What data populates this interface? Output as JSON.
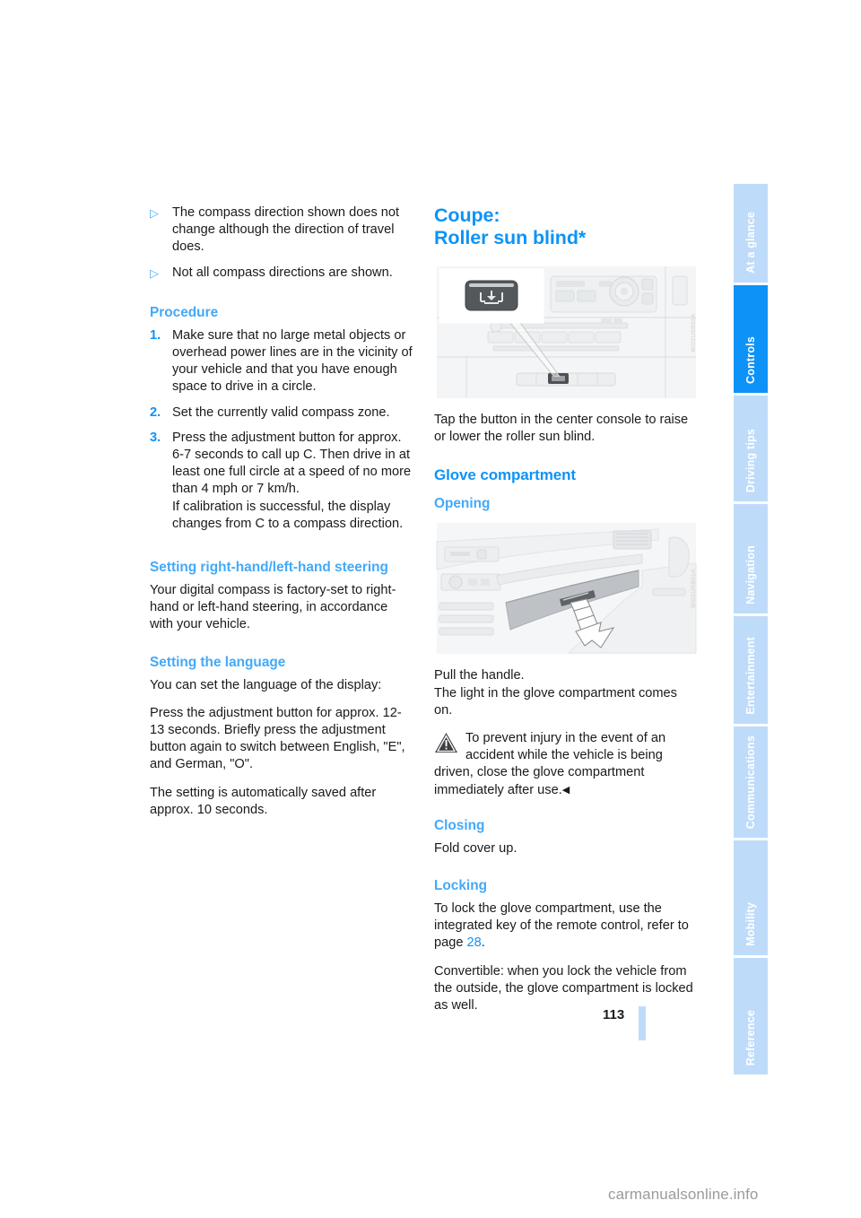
{
  "document": {
    "page_number": "113",
    "watermark": "carmanualsonline.info"
  },
  "sidebar": {
    "tabs": [
      {
        "label": "At a glance",
        "active": false
      },
      {
        "label": "Controls",
        "active": true
      },
      {
        "label": "Driving tips",
        "active": false
      },
      {
        "label": "Navigation",
        "active": false
      },
      {
        "label": "Entertainment",
        "active": false
      },
      {
        "label": "Communications",
        "active": false
      },
      {
        "label": "Mobility",
        "active": false
      },
      {
        "label": "Reference",
        "active": false
      }
    ],
    "colors": {
      "active": "#0d93f7",
      "inactive": "#bedcfa",
      "label": "#ffffff"
    }
  },
  "colors": {
    "heading_blue": "#0d93f7",
    "subheading_blue": "#43a9f8",
    "body_text": "#1a1a1a",
    "bullet_blue": "#4db0f9"
  },
  "left_column": {
    "bullets": [
      {
        "marker": "▷",
        "text": "The compass direction shown does not change although the direction of travel does."
      },
      {
        "marker": "▷",
        "text": "Not all compass directions are shown."
      }
    ],
    "procedure_heading": "Procedure",
    "procedure_steps": [
      {
        "marker": "1.",
        "text": "Make sure that no large metal objects or overhead power lines are in the vicinity of your vehicle and that you have enough space to drive in a circle."
      },
      {
        "marker": "2.",
        "text": "Set the currently valid compass zone."
      },
      {
        "marker": "3.",
        "text": "Press the adjustment button for approx. 6-7 seconds to call up C. Then drive in at least one full circle at a speed of no more than 4 mph or 7 km/h.\nIf calibration is successful, the display changes from C to a compass direction."
      }
    ],
    "steering_heading": "Setting right-hand/left-hand steering",
    "steering_text": "Your digital compass is factory-set to right-hand or left-hand steering, in accordance with your vehicle.",
    "language_heading": "Setting the language",
    "language_intro": "You can set the language of the display:",
    "language_para1": "Press the adjustment button for approx. 12-13 seconds. Briefly press the adjustment button again to switch between English, \"E\", and German, \"O\".",
    "language_para2": "The setting is automatically saved after approx. 10 seconds."
  },
  "right_column": {
    "chapter_title_line1": "Coupe:",
    "chapter_title_line2": "Roller sun blind*",
    "figure_console": {
      "alt": "center-console-with-roller-sun-blind-button",
      "id_code": "WO2USB02A",
      "callout_icon": "roller-sun-blind-button-icon"
    },
    "console_caption": "Tap the button in the center console to raise or lower the roller sun blind.",
    "glove_heading": "Glove compartment",
    "opening_heading": "Opening",
    "figure_glove": {
      "alt": "glove-compartment-handle-pull-arrow",
      "id_code": "WO2URB01A"
    },
    "open_line1": "Pull the handle.",
    "open_line2": "The light in the glove compartment comes on.",
    "warning_icon": "warning-triangle-icon",
    "warning_text": "To prevent injury in the event of an accident while the vehicle is being driven, close the glove compartment immediately after use.",
    "warning_endmark": "◀",
    "closing_heading": "Closing",
    "closing_text": "Fold cover up.",
    "locking_heading": "Locking",
    "locking_para1_before": "To lock the glove compartment, use the integrated key of the remote control, refer to page ",
    "locking_page_ref": "28",
    "locking_para1_after": ".",
    "locking_para2": "Convertible: when you lock the vehicle from the outside, the glove compartment is locked as well."
  }
}
